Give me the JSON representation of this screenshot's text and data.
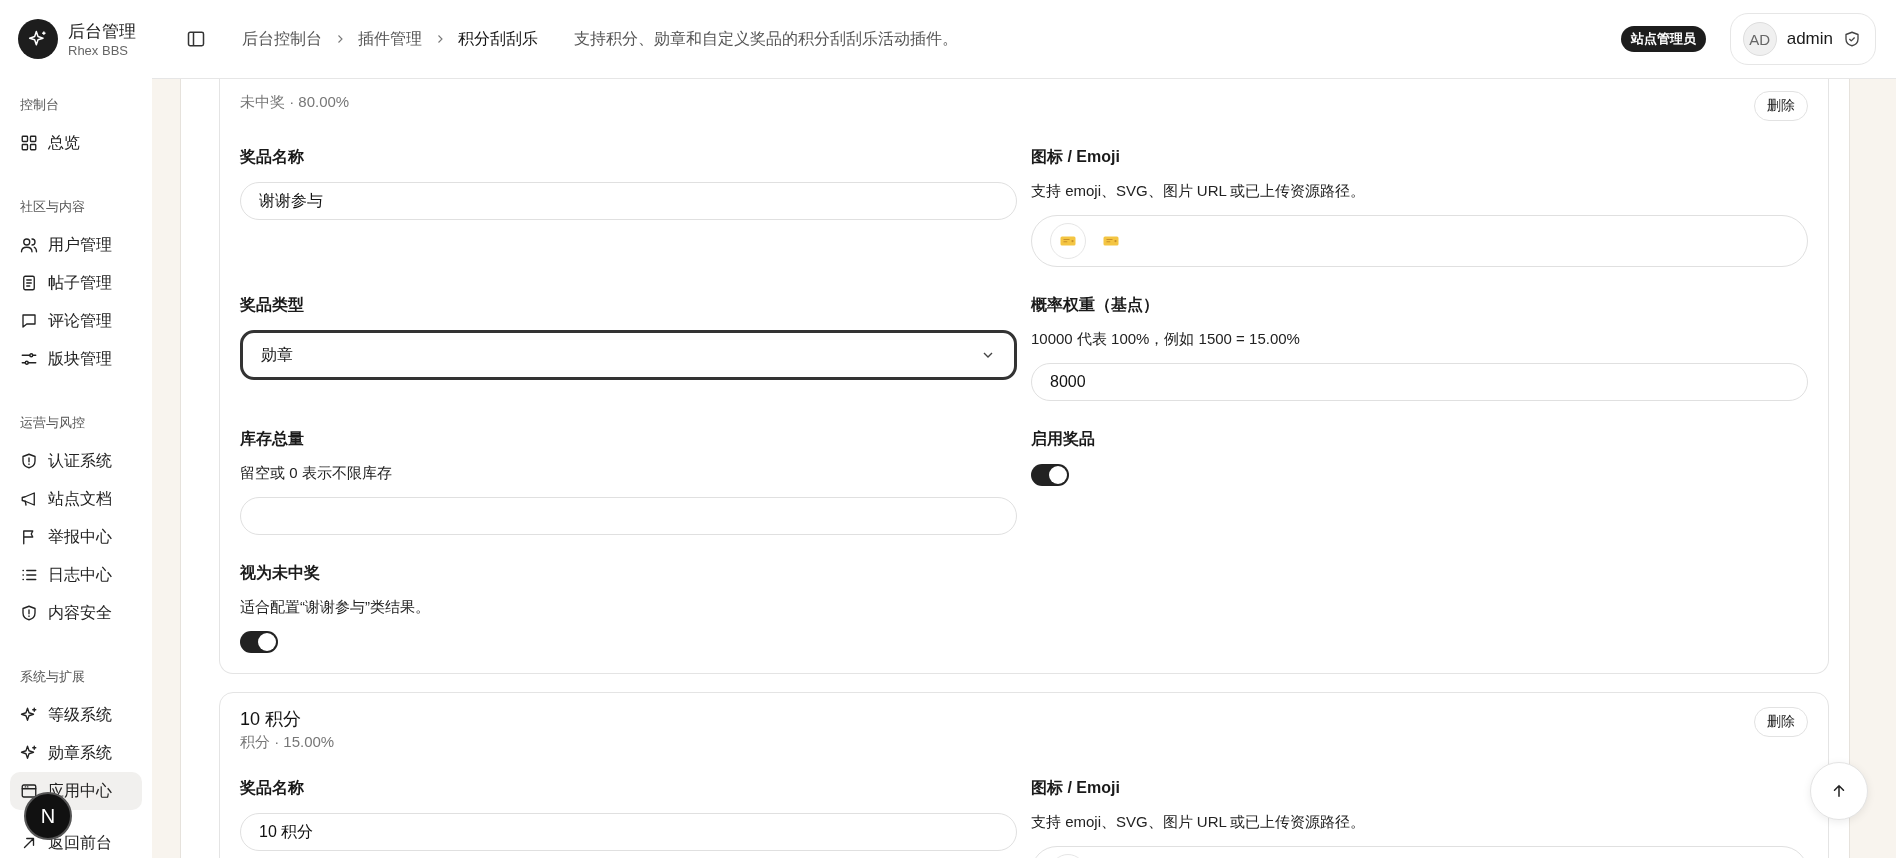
{
  "brand": {
    "title": "后台管理",
    "subtitle": "Rhex BBS"
  },
  "sidebar": {
    "sections": [
      {
        "label": "控制台",
        "items": [
          {
            "label": "总览",
            "selected": false
          }
        ]
      },
      {
        "label": "社区与内容",
        "items": [
          {
            "label": "用户管理",
            "selected": false
          },
          {
            "label": "帖子管理",
            "selected": false
          },
          {
            "label": "评论管理",
            "selected": false
          },
          {
            "label": "版块管理",
            "selected": false
          }
        ]
      },
      {
        "label": "运营与风控",
        "items": [
          {
            "label": "认证系统",
            "selected": false
          },
          {
            "label": "站点文档",
            "selected": false
          },
          {
            "label": "举报中心",
            "selected": false
          },
          {
            "label": "日志中心",
            "selected": false
          },
          {
            "label": "内容安全",
            "selected": false
          }
        ]
      },
      {
        "label": "系统与扩展",
        "items": [
          {
            "label": "等级系统",
            "selected": false
          },
          {
            "label": "勋章系统",
            "selected": false
          },
          {
            "label": "应用中心",
            "selected": true
          }
        ]
      }
    ],
    "footer_link": "返回前台",
    "dev_badge": "N"
  },
  "header": {
    "breadcrumb": [
      "后台控制台",
      "插件管理",
      "积分刮刮乐"
    ],
    "description": "支持积分、勋章和自定义奖品的积分刮刮乐活动插件。",
    "role_badge": "站点管理员",
    "user": {
      "avatar": "AD",
      "name": "admin"
    }
  },
  "prizes": [
    {
      "subtitle": "未中奖 · 80.00%",
      "delete_label": "删除",
      "fields": [
        {
          "kind": "text",
          "label": "奖品名称",
          "value": "谢谢参与"
        },
        {
          "kind": "emoji",
          "label": "图标 / Emoji",
          "help": "支持 emoji、SVG、图片 URL 或已上传资源路径。"
        },
        {
          "kind": "select",
          "label": "奖品类型",
          "value": "勋章",
          "focused": true
        },
        {
          "kind": "text",
          "label": "概率权重（基点）",
          "help": "10000 代表 100%，例如 1500 = 15.00%",
          "value": "8000"
        },
        {
          "kind": "text",
          "label": "库存总量",
          "help": "留空或 0 表示不限库存"
        },
        {
          "kind": "toggle",
          "label": "启用奖品",
          "on": true
        },
        {
          "kind": "toggle",
          "label": "视为未中奖",
          "help": "适合配置“谢谢参与”类结果。",
          "on": true
        }
      ]
    },
    {
      "title": "10 积分",
      "subtitle": "积分 · 15.00%",
      "delete_label": "删除",
      "fields": [
        {
          "kind": "text",
          "label": "奖品名称",
          "value": "10 积分"
        },
        {
          "kind": "emoji",
          "label": "图标 / Emoji",
          "help": "支持 emoji、SVG、图片 URL 或已上传资源路径。"
        }
      ]
    }
  ]
}
